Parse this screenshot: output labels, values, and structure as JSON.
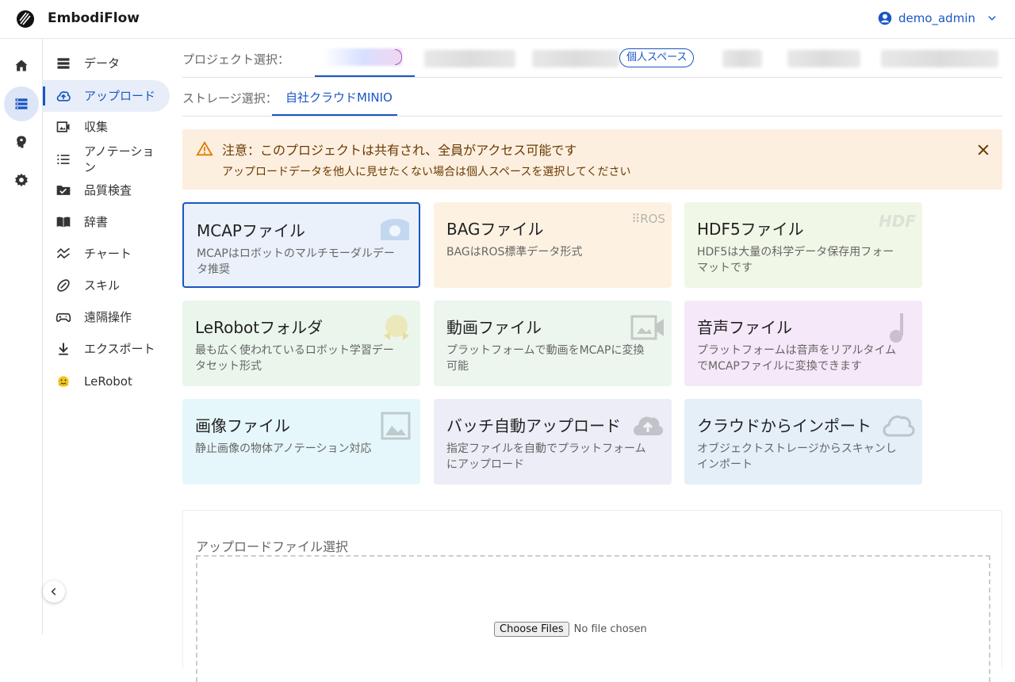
{
  "app": {
    "name": "EmbodiFlow"
  },
  "user": {
    "name": "demo_admin"
  },
  "rail": [
    {
      "icon": "home-icon"
    },
    {
      "icon": "storage-icon",
      "active": true
    },
    {
      "icon": "brain-icon"
    },
    {
      "icon": "gear-icon"
    }
  ],
  "nav": [
    {
      "label": "データ",
      "icon": "data-table-icon"
    },
    {
      "label": "アップロード",
      "icon": "cloud-upload-icon",
      "active": true
    },
    {
      "label": "収集",
      "icon": "video-capture-icon"
    },
    {
      "label": "アノテーション",
      "icon": "annotation-list-icon"
    },
    {
      "label": "品質検査",
      "icon": "quality-folder-icon"
    },
    {
      "label": "辞書",
      "icon": "book-icon"
    },
    {
      "label": "チャート",
      "icon": "chart-icon"
    },
    {
      "label": "スキル",
      "icon": "skill-icon"
    },
    {
      "label": "遠隔操作",
      "icon": "gamepad-icon"
    },
    {
      "label": "エクスポート",
      "icon": "download-icon"
    },
    {
      "label": "LeRobot",
      "icon": "hugging-face-icon"
    }
  ],
  "project": {
    "label": "プロジェクト選択：",
    "personal_badge": "個人スペース"
  },
  "storage": {
    "label": "ストレージ選択：",
    "selected": "自社クラウドMINIO"
  },
  "alert": {
    "title": "注意：このプロジェクトは共有され、全員がアクセス可能です",
    "message": "アップロードデータを他人に見せたくない場合は個人スペースを選択してください",
    "bg_color": "#fdefe0"
  },
  "cards": [
    {
      "title": "MCAPファイル",
      "desc": "MCAPはロボットのマルチモーダルデータ推奨",
      "bg": "#eaf1fb",
      "wm": "mcap",
      "selected": true
    },
    {
      "title": "BAGファイル",
      "desc": "BAGはROS標準データ形式",
      "bg": "#fdf2e2",
      "wm": "ros"
    },
    {
      "title": "HDF5ファイル",
      "desc": "HDF5は大量の科学データ保存用フォーマットです",
      "bg": "#f0f7e6",
      "wm": "hdf"
    },
    {
      "title": "LeRobotフォルダ",
      "desc": "最も広く使われているロボット学習データセット形式",
      "bg": "#eaf6ec",
      "wm": "hug"
    },
    {
      "title": "動画ファイル",
      "desc": "プラットフォームで動画をMCAPに変換可能",
      "bg": "#ecf6ee",
      "wm": "video"
    },
    {
      "title": "音声ファイル",
      "desc": "プラットフォームは音声をリアルタイムでMCAPファイルに変換できます",
      "bg": "#f5e8f8",
      "wm": "music"
    },
    {
      "title": "画像ファイル",
      "desc": "静止画像の物体アノテーション対応",
      "bg": "#e6f7fb",
      "wm": "image"
    },
    {
      "title": "バッチ自動アップロード",
      "desc": "指定ファイルを自動でプラットフォームにアップロード",
      "bg": "#ecedf6",
      "wm": "cloudup"
    },
    {
      "title": "クラウドからインポート",
      "desc": "オブジェクトストレージからスキャンしインポート",
      "bg": "#e5eff8",
      "wm": "cloud"
    }
  ],
  "upload": {
    "title": "アップロードファイル選択",
    "button": "Choose Files",
    "status": "No file chosen"
  },
  "colors": {
    "accent": "#1a56c4"
  }
}
